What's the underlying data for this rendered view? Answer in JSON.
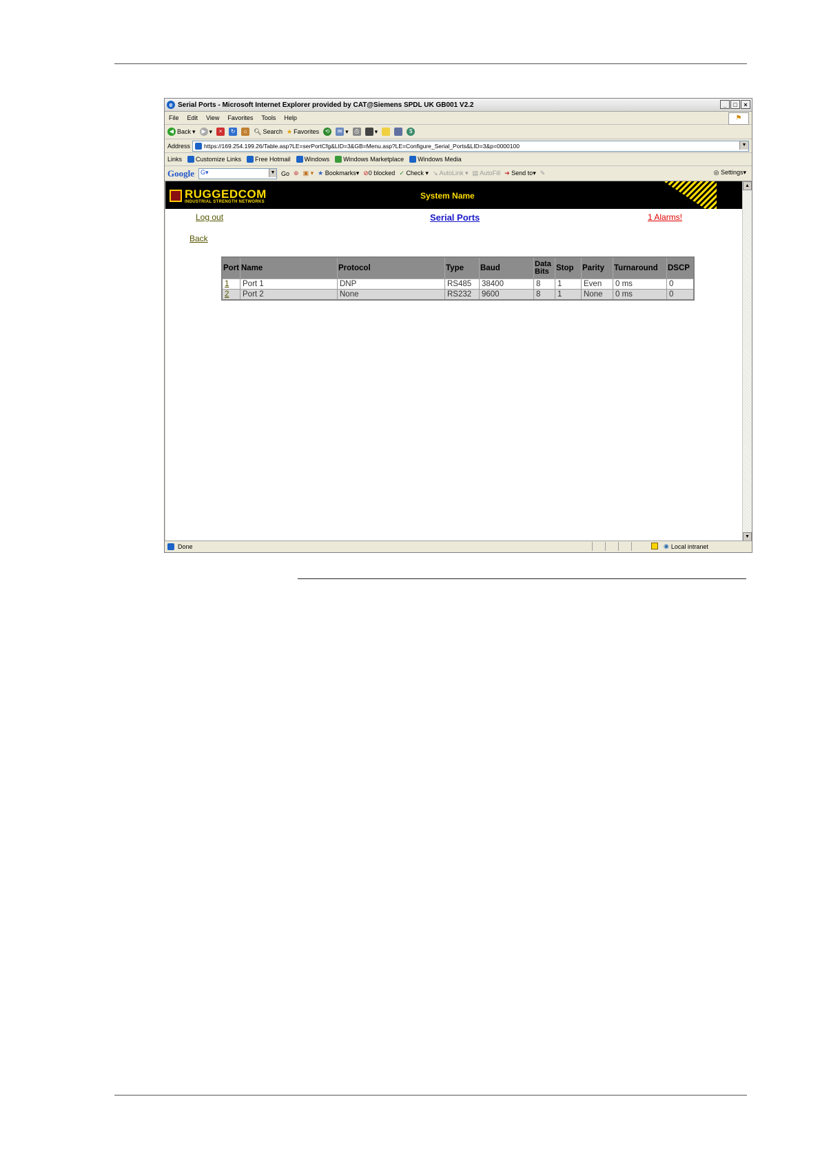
{
  "browser": {
    "title": "Serial Ports - Microsoft Internet Explorer provided by CAT@Siemens SPDL UK GB001 V2.2",
    "menu": [
      "File",
      "Edit",
      "View",
      "Favorites",
      "Tools",
      "Help"
    ],
    "toolbar": {
      "back": "Back",
      "search": "Search",
      "favorites": "Favorites"
    },
    "address_label": "Address",
    "address_value": "https://169.254.199.26/Table.asp?LE=serPortCfg&LID=3&GB=Menu.asp?LE=Configure_Serial_Ports&LID=3&p=0000100",
    "links_label": "Links",
    "links": [
      "Customize Links",
      "Free Hotmail",
      "Windows",
      "Windows Marketplace",
      "Windows Media"
    ],
    "google": {
      "logo": "Google",
      "go": "Go",
      "bookmarks": "Bookmarks",
      "blocked": "0 blocked",
      "check": "Check",
      "autolink": "AutoLink",
      "autofill": "AutoFill",
      "sendto": "Send to",
      "settings": "Settings"
    },
    "status": {
      "text": "Done",
      "zone": "Local intranet"
    }
  },
  "page": {
    "logo": "RUGGEDCOM",
    "logo_tagline": "INDUSTRIAL STRENGTH NETWORKS",
    "system_name": "System Name",
    "logout": "Log out",
    "title": "Serial Ports",
    "alarms": "1 Alarms!",
    "back": "Back"
  },
  "table": {
    "headers": [
      "Port",
      "Name",
      "Protocol",
      "Type",
      "Baud",
      "Data Bits",
      "Stop",
      "Parity",
      "Turnaround",
      "DSCP"
    ],
    "rows": [
      [
        "1",
        "Port 1",
        "DNP",
        "RS485",
        "38400",
        "8",
        "1",
        "Even",
        "0 ms",
        "0"
      ],
      [
        "2",
        "Port 2",
        "None",
        "RS232",
        "9600",
        "8",
        "1",
        "None",
        "0 ms",
        "0"
      ]
    ]
  }
}
